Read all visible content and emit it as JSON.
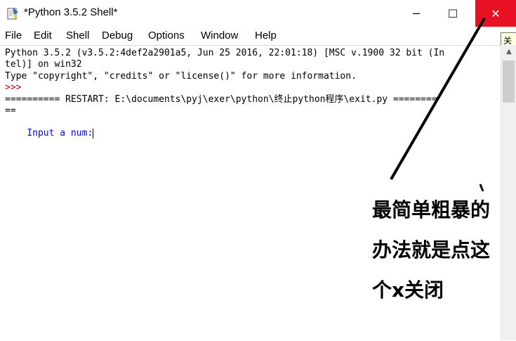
{
  "window": {
    "title": "*Python 3.5.2 Shell*",
    "buttons": {
      "minimize": "─",
      "maximize": "☐",
      "close": "✕"
    }
  },
  "menu": [
    "File",
    "Edit",
    "Shell",
    "Debug",
    "Options",
    "Window",
    "Help"
  ],
  "tooltip": {
    "text": "关闭"
  },
  "shell": {
    "lines": [
      "Python 3.5.2 (v3.5.2:4def2a2901a5, Jun 25 2016, 22:01:18) [MSC v.1900 32 bit (In",
      "tel)] on win32",
      "Type \"copyright\", \"credits\" or \"license()\" for more information.",
      ">>>",
      "========== RESTART: E:\\documents\\pyj\\exer\\python\\终止python程序\\exit.py ========",
      "==",
      "Input a num:"
    ]
  },
  "annotation": {
    "lines": [
      "最简单粗暴的",
      "办法就是点这",
      "个x关闭"
    ]
  },
  "colors": {
    "close_button": "#e81123",
    "prompt": "#c00000",
    "input_prompt": "#0000ff"
  },
  "icons": {
    "app": "python-idle-icon",
    "arrow": "annotation-arrow"
  }
}
